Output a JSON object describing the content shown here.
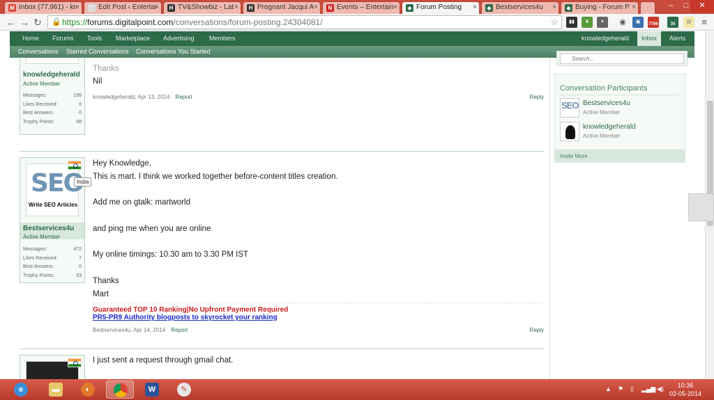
{
  "browser": {
    "tabs": [
      {
        "title": "Inbox (77,961) - kn",
        "icon": "gmail-icon",
        "color": "#d44638"
      },
      {
        "title": "Edit Post ‹ Entertai",
        "icon": "page-icon",
        "color": "#999999"
      },
      {
        "title": "TV&Showbiz - Lat",
        "icon": "page-icon",
        "color": "#333333"
      },
      {
        "title": "Pregnant Jacqui A",
        "icon": "page-icon",
        "color": "#333333"
      },
      {
        "title": "Events – Entertain",
        "icon": "page-icon",
        "color": "#cc2222"
      },
      {
        "title": "Forum Posting",
        "icon": "forum-icon",
        "color": "#2c6a48"
      },
      {
        "title": "Bestservices4u",
        "icon": "forum-icon",
        "color": "#2c6a48"
      },
      {
        "title": "Buying - Forum P",
        "icon": "forum-icon",
        "color": "#2c6a48"
      }
    ],
    "url_scheme": "https://",
    "url_host": "forums.digitalpoint.com",
    "url_path": "/conversations/forum-posting.24304081/",
    "ext_badges": {
      "mail_count": "7796",
      "other_count": "30"
    }
  },
  "site_nav": {
    "items": [
      "Home",
      "Forums",
      "Tools",
      "Marketplace",
      "Advertising",
      "Members"
    ],
    "username": "knowledgeherald",
    "inbox": "Inbox",
    "alerts": "Alerts"
  },
  "sub_nav": {
    "items": [
      "Conversations",
      "Starred Conversations",
      "Conversations You Started"
    ]
  },
  "posts": [
    {
      "author": "knowledgeherald",
      "role": "Active Member",
      "stats": [
        {
          "label": "Messages:",
          "value": "199"
        },
        {
          "label": "Likes Received:",
          "value": "6"
        },
        {
          "label": "Best Answers:",
          "value": "0"
        },
        {
          "label": "Trophy Points:",
          "value": "58"
        }
      ],
      "lines": [
        "Thanks",
        "Nil"
      ],
      "meta_author": "knowledgeherald,",
      "meta_date": "Apr 13, 2014",
      "report": "Report",
      "reply": "Reply"
    },
    {
      "author": "Bestservices4u",
      "role": "Active Member",
      "avatar_text": "SEO",
      "avatar_caption": "Write SEO Articles",
      "flag_tooltip": "India",
      "stats": [
        {
          "label": "Messages:",
          "value": "472"
        },
        {
          "label": "Likes Received:",
          "value": "7"
        },
        {
          "label": "Best Answers:",
          "value": "0"
        },
        {
          "label": "Trophy Points:",
          "value": "53"
        }
      ],
      "lines": [
        "Hey Knowledge,",
        "This is mart. I think we worked together before-content titles creation.",
        "Add me on gtalk: martworld",
        "and ping me when you are online",
        "My online timings: 10.30 am to 3.30 PM IST",
        "Thanks",
        "Mart"
      ],
      "signature": [
        "Guaranteed TOP 10 Ranking|No Upfront Payment Required",
        "PR5-PR9 Authority blogposts to skyrocket your ranking"
      ],
      "meta_author": "Bestservices4u,",
      "meta_date": "Apr 14, 2014",
      "report": "Report",
      "reply": "Reply"
    },
    {
      "lines": [
        "I just sent a request through gmail chat."
      ]
    }
  ],
  "sidebar": {
    "search_placeholder": "Search...",
    "participants_title": "Conversation Participants",
    "participants": [
      {
        "name": "Bestservices4u",
        "role": "Active Member"
      },
      {
        "name": "knowledgeherald",
        "role": "Active Member"
      }
    ],
    "invite": "Invite More"
  },
  "taskbar": {
    "time": "10:36",
    "date": "02-05-2014"
  }
}
